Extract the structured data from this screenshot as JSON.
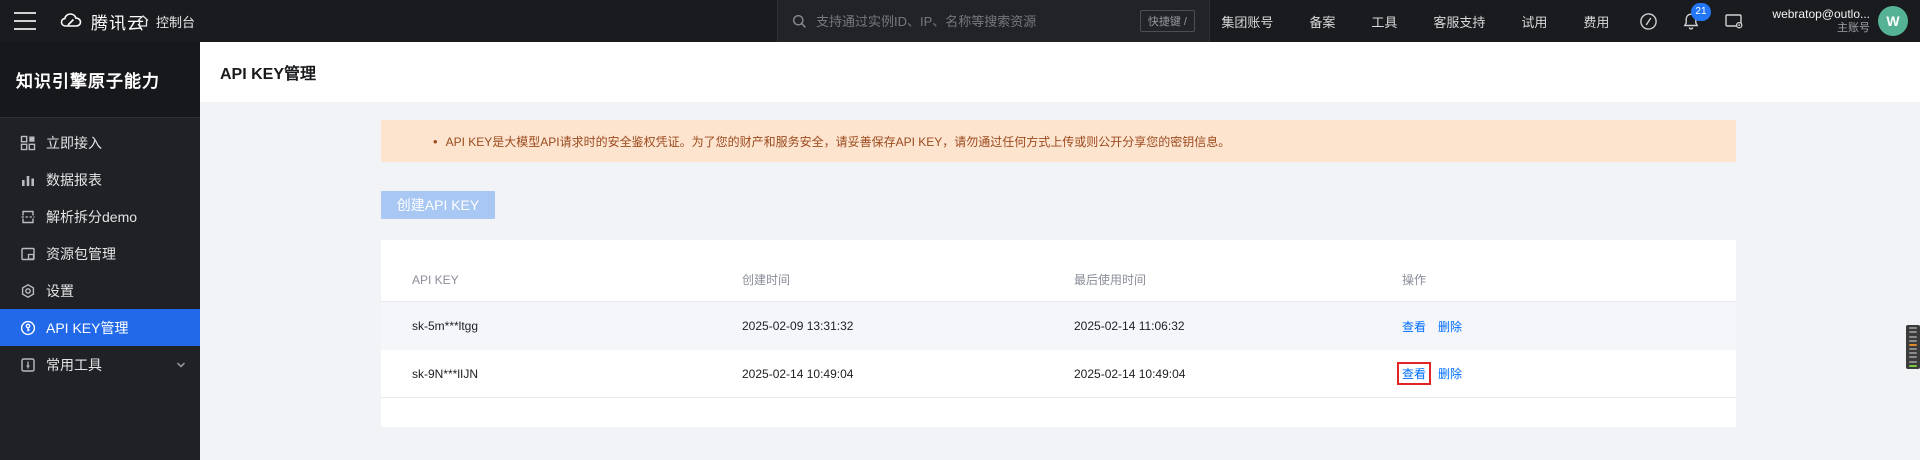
{
  "topbar": {
    "logo_text": "腾讯云",
    "console_label": "控制台",
    "search": {
      "placeholder": "支持通过实例ID、IP、名称等搜索资源",
      "shortcut": "快捷键 /"
    },
    "nav_items": [
      "集团账号",
      "备案",
      "工具",
      "客服支持",
      "试用",
      "费用"
    ],
    "notification_count": "21",
    "user": {
      "email": "webratop@outlo...",
      "role": "主账号",
      "avatar_initial": "W"
    }
  },
  "sidebar": {
    "title": "知识引擎原子能力",
    "items": [
      {
        "label": "立即接入",
        "icon": "grid-icon",
        "active": false
      },
      {
        "label": "数据报表",
        "icon": "bar-chart-icon",
        "active": false
      },
      {
        "label": "解析拆分demo",
        "icon": "split-icon",
        "active": false
      },
      {
        "label": "资源包管理",
        "icon": "package-icon",
        "active": false
      },
      {
        "label": "设置",
        "icon": "gear-icon",
        "active": false
      },
      {
        "label": "API KEY管理",
        "icon": "key-circle-icon",
        "active": true
      },
      {
        "label": "常用工具",
        "icon": "tools-icon",
        "active": false,
        "expandable": true
      }
    ]
  },
  "page": {
    "title": "API KEY管理",
    "banner": {
      "bullet": "•",
      "text": "API KEY是大模型API请求时的安全鉴权凭证。为了您的财产和服务安全，请妥善保存API KEY，请勿通过任何方式上传或则公开分享您的密钥信息。"
    },
    "create_button_label": "创建API KEY",
    "table": {
      "columns": [
        "API KEY",
        "创建时间",
        "最后使用时间",
        "操作"
      ],
      "rows": [
        {
          "api_key": "sk-5m***ltgg",
          "created": "2025-02-09 13:31:32",
          "last_used": "2025-02-14 11:06:32",
          "view_label": "查看",
          "delete_label": "删除"
        },
        {
          "api_key": "sk-9N***lIJN",
          "created": "2025-02-14 10:49:04",
          "last_used": "2025-02-14 10:49:04",
          "view_label": "查看",
          "delete_label": "删除"
        }
      ],
      "annotation": {
        "row": 1,
        "action": "查看",
        "color": "#e12525"
      }
    }
  },
  "minimap": {
    "line_colors": [
      "#8b8b8b",
      "#8b8b8b",
      "#8b8b8b",
      "#8b8b8b",
      "#e2882f",
      "#8b8b8b",
      "#8b8b8b",
      "#8b8b8b",
      "#8b8b8b",
      "#7dc63f"
    ]
  },
  "colors": {
    "accent_blue": "#006eff",
    "sidebar_active_blue": "#2169e8",
    "banner_bg": "#fce4cf",
    "banner_text": "#9c4a1e",
    "badge_blue": "#2377f6",
    "avatar_green": "#56b295",
    "annotation_red": "#e12525",
    "disabled_button_blue": "#a8c7f3"
  }
}
